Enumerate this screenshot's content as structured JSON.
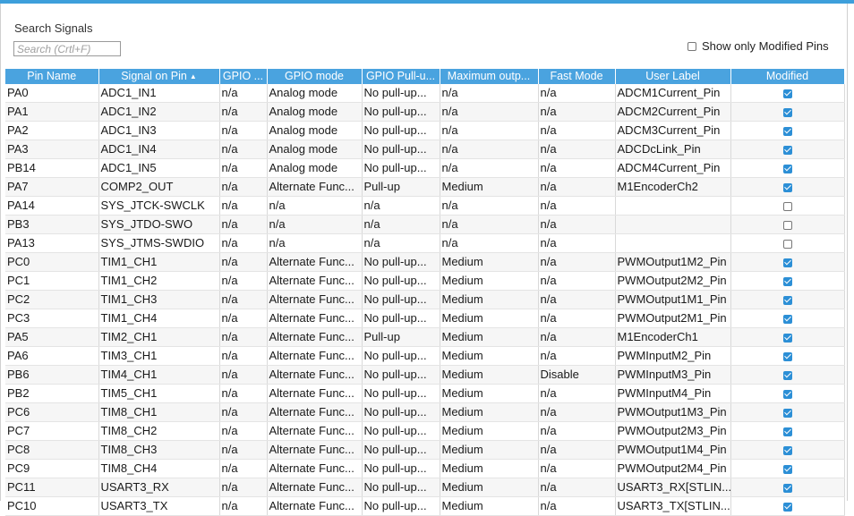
{
  "search": {
    "label": "Search Signals",
    "placeholder": "Search (Crtl+F)"
  },
  "filter": {
    "show_modified_label": "Show only Modified Pins",
    "checked": false
  },
  "table": {
    "columns": [
      "Pin Name",
      "Signal on Pin",
      "GPIO ...",
      "GPIO mode",
      "GPIO Pull-u...",
      "Maximum outp...",
      "Fast Mode",
      "User Label",
      "Modified"
    ],
    "sort_icon": "sort-ascending-icon",
    "rows": [
      {
        "pin": "PA0",
        "signal": "ADC1_IN1",
        "gpio": "n/a",
        "mode": "Analog mode",
        "pull": "No pull-up...",
        "max": "n/a",
        "fast": "n/a",
        "label": "ADCM1Current_Pin",
        "modified": true
      },
      {
        "pin": "PA1",
        "signal": "ADC1_IN2",
        "gpio": "n/a",
        "mode": "Analog mode",
        "pull": "No pull-up...",
        "max": "n/a",
        "fast": "n/a",
        "label": "ADCM2Current_Pin",
        "modified": true
      },
      {
        "pin": "PA2",
        "signal": "ADC1_IN3",
        "gpio": "n/a",
        "mode": "Analog mode",
        "pull": "No pull-up...",
        "max": "n/a",
        "fast": "n/a",
        "label": "ADCM3Current_Pin",
        "modified": true
      },
      {
        "pin": "PA3",
        "signal": "ADC1_IN4",
        "gpio": "n/a",
        "mode": "Analog mode",
        "pull": "No pull-up...",
        "max": "n/a",
        "fast": "n/a",
        "label": "ADCDcLink_Pin",
        "modified": true
      },
      {
        "pin": "PB14",
        "signal": "ADC1_IN5",
        "gpio": "n/a",
        "mode": "Analog mode",
        "pull": "No pull-up...",
        "max": "n/a",
        "fast": "n/a",
        "label": "ADCM4Current_Pin",
        "modified": true
      },
      {
        "pin": "PA7",
        "signal": "COMP2_OUT",
        "gpio": "n/a",
        "mode": "Alternate Func...",
        "pull": "Pull-up",
        "max": "Medium",
        "fast": "n/a",
        "label": "M1EncoderCh2",
        "modified": true
      },
      {
        "pin": "PA14",
        "signal": "SYS_JTCK-SWCLK",
        "gpio": "n/a",
        "mode": "n/a",
        "pull": "n/a",
        "max": "n/a",
        "fast": "n/a",
        "label": "",
        "modified": false
      },
      {
        "pin": "PB3",
        "signal": "SYS_JTDO-SWO",
        "gpio": "n/a",
        "mode": "n/a",
        "pull": "n/a",
        "max": "n/a",
        "fast": "n/a",
        "label": "",
        "modified": false
      },
      {
        "pin": "PA13",
        "signal": "SYS_JTMS-SWDIO",
        "gpio": "n/a",
        "mode": "n/a",
        "pull": "n/a",
        "max": "n/a",
        "fast": "n/a",
        "label": "",
        "modified": false
      },
      {
        "pin": "PC0",
        "signal": "TIM1_CH1",
        "gpio": "n/a",
        "mode": "Alternate Func...",
        "pull": "No pull-up...",
        "max": "Medium",
        "fast": "n/a",
        "label": "PWMOutput1M2_Pin",
        "modified": true
      },
      {
        "pin": "PC1",
        "signal": "TIM1_CH2",
        "gpio": "n/a",
        "mode": "Alternate Func...",
        "pull": "No pull-up...",
        "max": "Medium",
        "fast": "n/a",
        "label": "PWMOutput2M2_Pin",
        "modified": true
      },
      {
        "pin": "PC2",
        "signal": "TIM1_CH3",
        "gpio": "n/a",
        "mode": "Alternate Func...",
        "pull": "No pull-up...",
        "max": "Medium",
        "fast": "n/a",
        "label": "PWMOutput1M1_Pin",
        "modified": true
      },
      {
        "pin": "PC3",
        "signal": "TIM1_CH4",
        "gpio": "n/a",
        "mode": "Alternate Func...",
        "pull": "No pull-up...",
        "max": "Medium",
        "fast": "n/a",
        "label": "PWMOutput2M1_Pin",
        "modified": true
      },
      {
        "pin": "PA5",
        "signal": "TIM2_CH1",
        "gpio": "n/a",
        "mode": "Alternate Func...",
        "pull": "Pull-up",
        "max": "Medium",
        "fast": "n/a",
        "label": "M1EncoderCh1",
        "modified": true
      },
      {
        "pin": "PA6",
        "signal": "TIM3_CH1",
        "gpio": "n/a",
        "mode": "Alternate Func...",
        "pull": "No pull-up...",
        "max": "Medium",
        "fast": "n/a",
        "label": "PWMInputM2_Pin",
        "modified": true
      },
      {
        "pin": "PB6",
        "signal": "TIM4_CH1",
        "gpio": "n/a",
        "mode": "Alternate Func...",
        "pull": "No pull-up...",
        "max": "Medium",
        "fast": "Disable",
        "label": "PWMInputM3_Pin",
        "modified": true
      },
      {
        "pin": "PB2",
        "signal": "TIM5_CH1",
        "gpio": "n/a",
        "mode": "Alternate Func...",
        "pull": "No pull-up...",
        "max": "Medium",
        "fast": "n/a",
        "label": "PWMInputM4_Pin",
        "modified": true
      },
      {
        "pin": "PC6",
        "signal": "TIM8_CH1",
        "gpio": "n/a",
        "mode": "Alternate Func...",
        "pull": "No pull-up...",
        "max": "Medium",
        "fast": "n/a",
        "label": "PWMOutput1M3_Pin",
        "modified": true
      },
      {
        "pin": "PC7",
        "signal": "TIM8_CH2",
        "gpio": "n/a",
        "mode": "Alternate Func...",
        "pull": "No pull-up...",
        "max": "Medium",
        "fast": "n/a",
        "label": "PWMOutput2M3_Pin",
        "modified": true
      },
      {
        "pin": "PC8",
        "signal": "TIM8_CH3",
        "gpio": "n/a",
        "mode": "Alternate Func...",
        "pull": "No pull-up...",
        "max": "Medium",
        "fast": "n/a",
        "label": "PWMOutput1M4_Pin",
        "modified": true
      },
      {
        "pin": "PC9",
        "signal": "TIM8_CH4",
        "gpio": "n/a",
        "mode": "Alternate Func...",
        "pull": "No pull-up...",
        "max": "Medium",
        "fast": "n/a",
        "label": "PWMOutput2M4_Pin",
        "modified": true
      },
      {
        "pin": "PC11",
        "signal": "USART3_RX",
        "gpio": "n/a",
        "mode": "Alternate Func...",
        "pull": "No pull-up...",
        "max": "Medium",
        "fast": "n/a",
        "label": "USART3_RX[STLIN...",
        "modified": true
      },
      {
        "pin": "PC10",
        "signal": "USART3_TX",
        "gpio": "n/a",
        "mode": "Alternate Func...",
        "pull": "No pull-up...",
        "max": "Medium",
        "fast": "n/a",
        "label": "USART3_TX[STLIN...",
        "modified": true
      }
    ]
  },
  "colors": {
    "header_bg": "#4aa3df",
    "accent": "#3d9fdb",
    "checkbox": "#2c8fd6"
  }
}
